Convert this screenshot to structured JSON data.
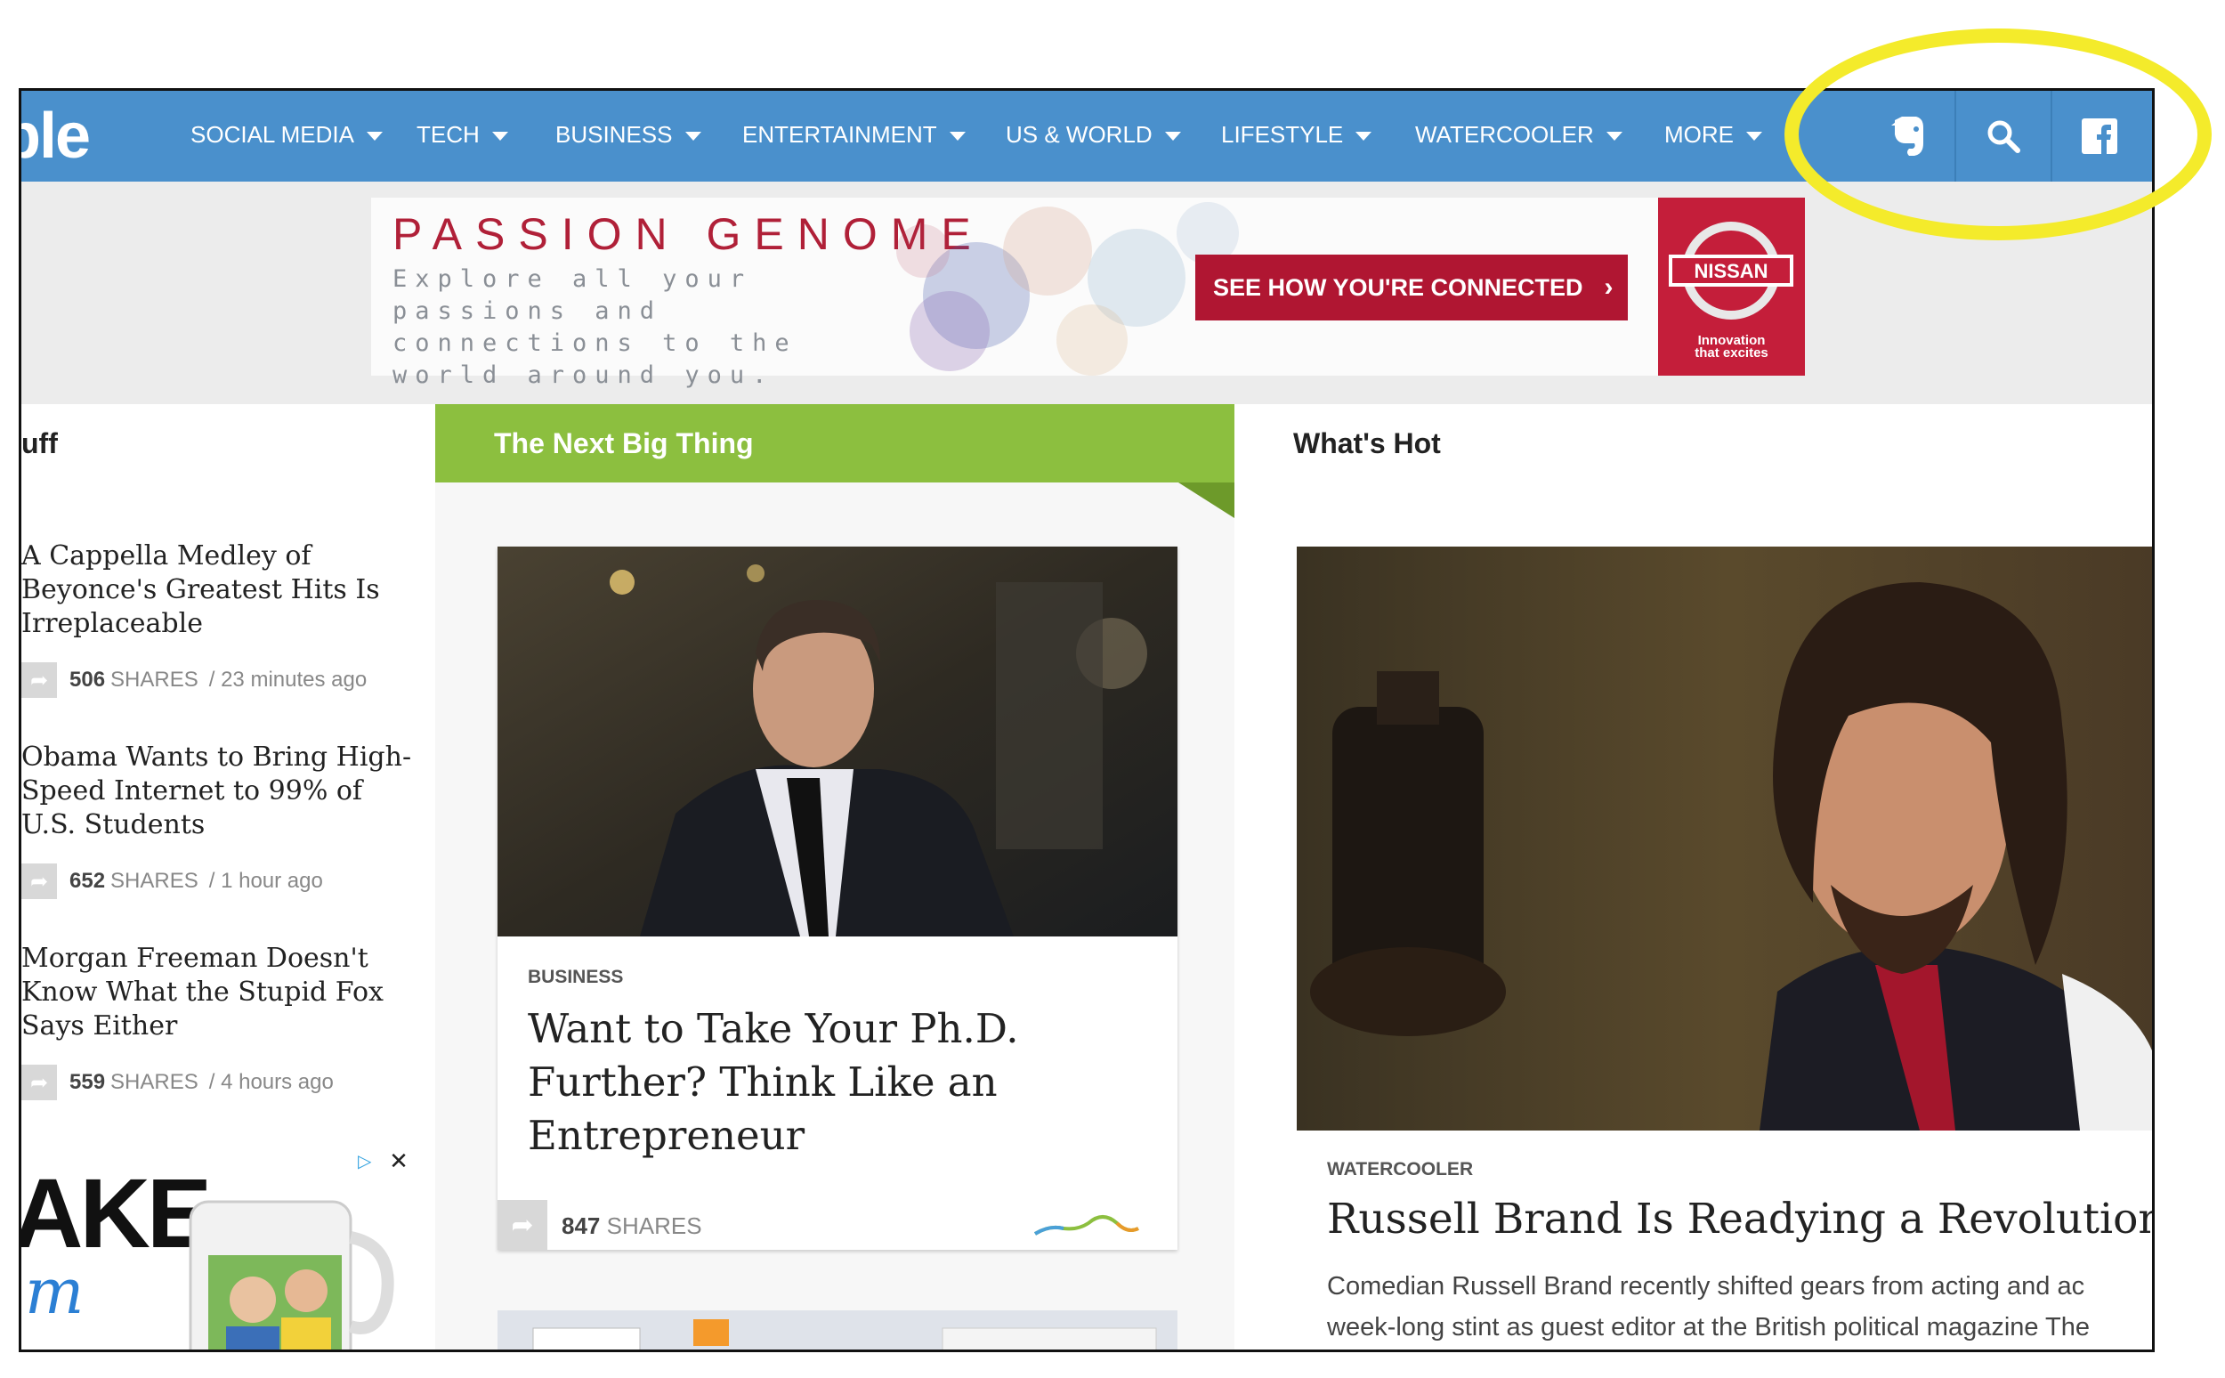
{
  "nav": {
    "logo": "ble",
    "items": [
      "SOCIAL MEDIA",
      "TECH",
      "BUSINESS",
      "ENTERTAINMENT",
      "US & WORLD",
      "LIFESTYLE",
      "WATERCOOLER",
      "MORE"
    ],
    "icons": [
      "evernote-icon",
      "search-icon",
      "facebook-icon"
    ],
    "bar_color": "#4a90cc"
  },
  "ad": {
    "title": "PASSION GENOME",
    "subtitle": "Explore all your passions and connections to the world around you.",
    "cta": "SEE HOW YOU'RE CONNECTED",
    "brand": "NISSAN",
    "tagline_1": "Innovation",
    "tagline_2": "that excites"
  },
  "columns": {
    "left_header": "uff",
    "mid_header": "The Next Big Thing",
    "right_header": "What's Hot"
  },
  "left_items": [
    {
      "title": "A Cappella Medley of Beyonce's Greatest Hits Is Irreplaceable",
      "shares": "506",
      "shares_label": "SHARES",
      "time": "/ 23 minutes ago"
    },
    {
      "title": "Obama Wants to Bring High-Speed Internet to 99% of U.S. Students",
      "shares": "652",
      "shares_label": "SHARES",
      "time": "/ 1 hour ago"
    },
    {
      "title": "Morgan Freeman Doesn't Know What the Stupid Fox Says Either",
      "shares": "559",
      "shares_label": "SHARES",
      "time": "/ 4 hours ago"
    }
  ],
  "small_ad": {
    "big_text": "AKE",
    "script_text": "m"
  },
  "mid_card": {
    "category": "BUSINESS",
    "title": "Want to Take Your Ph.D. Further? Think Like an Entrepreneur",
    "shares": "847",
    "shares_label": "SHARES"
  },
  "right_card": {
    "category": "WATERCOOLER",
    "title": "Russell Brand Is Readying a Revolution",
    "desc_1": "Comedian Russell Brand recently shifted gears from acting and ac",
    "desc_2": "week-long stint as guest editor at the British political magazine The"
  },
  "colors": {
    "accent_green": "#8cbf3f",
    "highlight": "#f4eb2b",
    "ad_red": "#b01632"
  }
}
